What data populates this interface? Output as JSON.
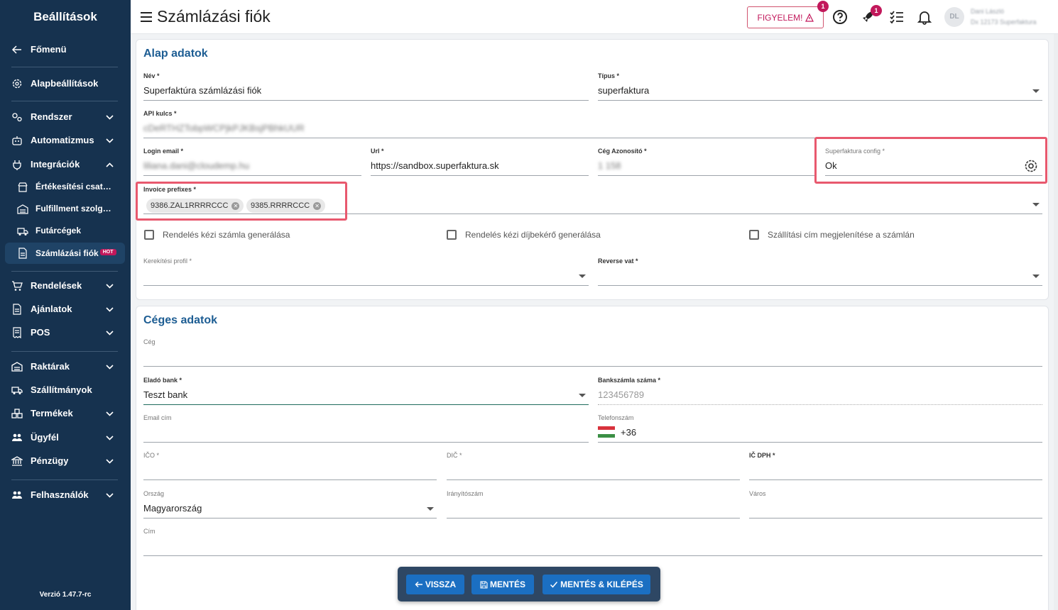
{
  "sidebar": {
    "title": "Beállítások",
    "version": "Verzió 1.47.7-rc",
    "items": [
      {
        "label": "Főmenü",
        "icon": "arrow-left-icon"
      },
      {
        "label": "Alapbeállítások",
        "icon": "gear-icon"
      },
      {
        "label": "Rendszer",
        "icon": "gears-icon"
      },
      {
        "label": "Automatizmus",
        "icon": "robot-icon"
      },
      {
        "label": "Integrációk",
        "icon": "plug-icon"
      },
      {
        "label": "Értékesítési csatornák",
        "icon": "storefront-icon"
      },
      {
        "label": "Fulfillment szolgáltatók",
        "icon": "warehouse-icon"
      },
      {
        "label": "Futárcégek",
        "icon": "delivery-truck-icon"
      },
      {
        "label": "Számlázási fiók",
        "icon": "document-icon",
        "badge": "HOT"
      },
      {
        "label": "Rendelések",
        "icon": "cart-icon"
      },
      {
        "label": "Ajánlatok",
        "icon": "document-icon"
      },
      {
        "label": "POS",
        "icon": "receipt-icon"
      },
      {
        "label": "Raktárak",
        "icon": "warehouse-icon"
      },
      {
        "label": "Szállítmányok",
        "icon": "truck-icon"
      },
      {
        "label": "Termékek",
        "icon": "boxes-icon"
      },
      {
        "label": "Ügyfél",
        "icon": "users-icon"
      },
      {
        "label": "Pénzügy",
        "icon": "bank-icon"
      },
      {
        "label": "Felhasználók",
        "icon": "users-icon"
      }
    ]
  },
  "header": {
    "title": "Számlázási fiók",
    "alert_label": "FIGYELEM!",
    "alert_badge": "1",
    "rocket_badge": "1",
    "avatar_initials": "DL",
    "user_name": "Dani László",
    "user_company": "Dx 12173 Superfaktura"
  },
  "basic": {
    "title": "Alap adatok",
    "name_label": "Név *",
    "name_value": "Superfaktúra számlázási fiók",
    "type_label": "Típus *",
    "type_value": "superfaktura",
    "api_label": "API kulcs *",
    "api_value": "cDeRTHZTobpWCPjkPJKBsjPBhkUUR",
    "login_label": "Login email *",
    "login_value": "liliana.dani@cloudemp.hu",
    "url_label": "Url *",
    "url_value": "https://sandbox.superfaktura.sk",
    "company_id_label": "Cég Azonosító *",
    "company_id_value": "1 158",
    "config_label": "Superfaktura config *",
    "config_value": "Ok",
    "prefix_label": "Invoice prefixes *",
    "prefixes": [
      "9386.ZAL1RRRRCCC",
      "9385.RRRRCCC"
    ],
    "cb1": "Rendelés kézi számla generálása",
    "cb2": "Rendelés kézi díjbekérő generálása",
    "cb3": "Szállítási cím megjelenítése a számlán",
    "rounding_label": "Kerekítési profil *",
    "reverse_label": "Reverse vat *"
  },
  "company": {
    "title": "Céges adatok",
    "company_label": "Cég",
    "bank_label": "Eladó bank *",
    "bank_value": "Teszt bank",
    "account_label": "Bankszámla száma *",
    "account_placeholder": "123456789",
    "email_label": "Email cím",
    "phone_label": "Telefonszám",
    "phone_prefix": "+36",
    "ico_label": "IČO *",
    "dic_label": "DIČ *",
    "icdph_label": "IČ DPH *",
    "country_label": "Ország",
    "country_value": "Magyarország",
    "zip_label": "Irányítószám",
    "city_label": "Város",
    "address_label": "Cím"
  },
  "footer": {
    "back": "VISSZA",
    "save": "MENTÉS",
    "save_exit": "MENTÉS & KILÉPÉS"
  },
  "colors": {
    "sidebar": "#16324f",
    "accent": "#1d5d93",
    "button": "#1b6fc2",
    "alert": "#c2185b",
    "highlight": "#e8596e"
  }
}
